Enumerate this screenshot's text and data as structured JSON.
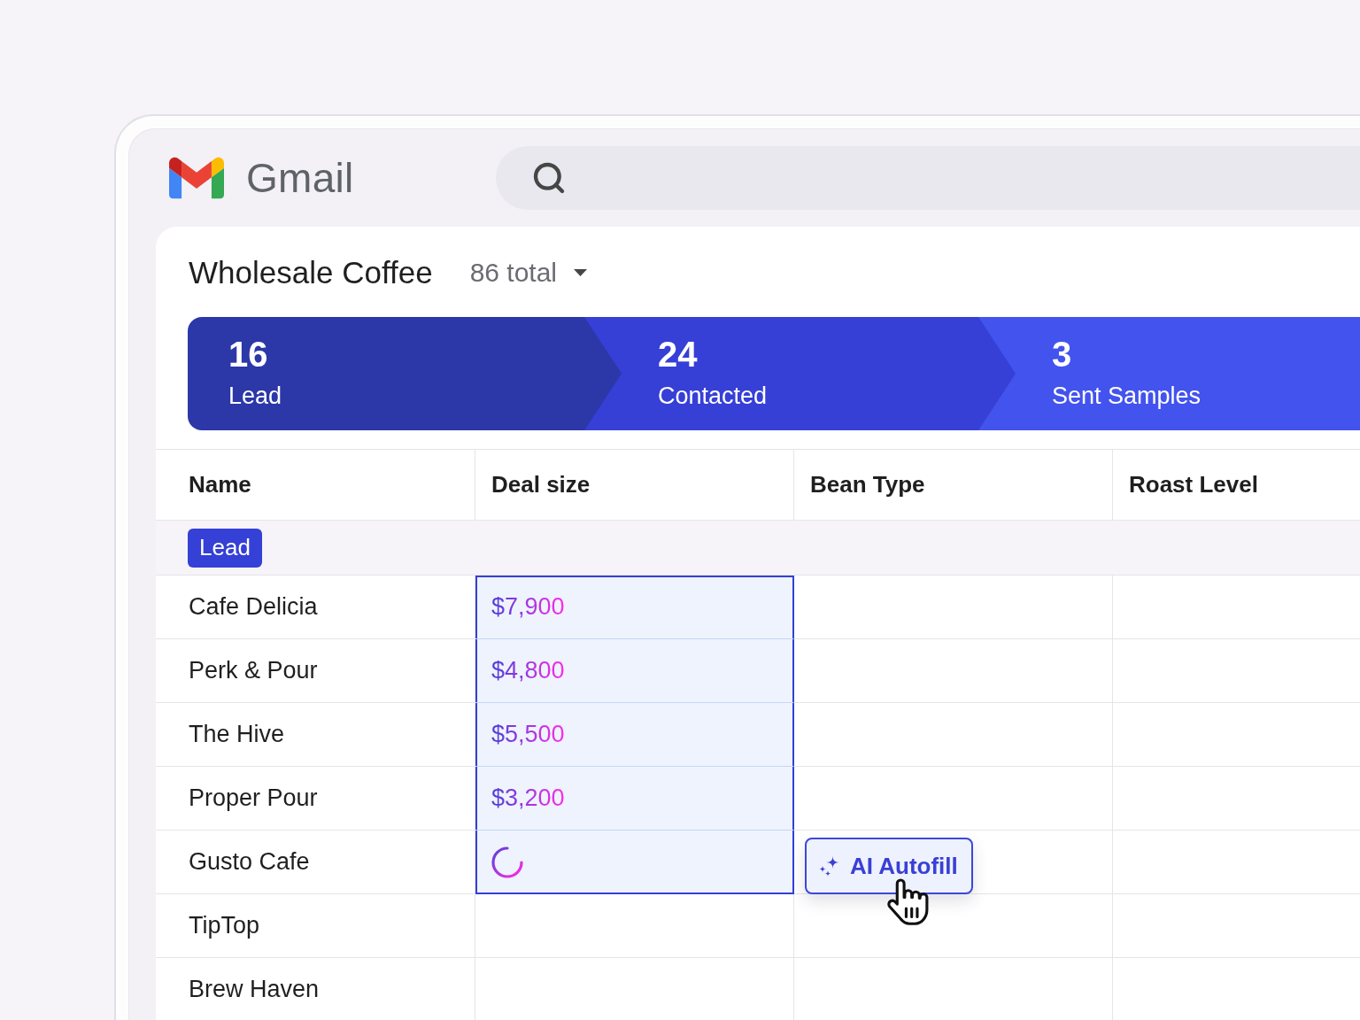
{
  "app": {
    "name": "Gmail"
  },
  "view": {
    "title": "Wholesale Coffee",
    "total": "86 total"
  },
  "pipeline": {
    "stages": [
      {
        "count": "16",
        "label": "Lead",
        "color": "#2c37a8"
      },
      {
        "count": "24",
        "label": "Contacted",
        "color": "#3640d6"
      },
      {
        "count": "3",
        "label": "Sent Samples",
        "color": "#4353ee"
      }
    ]
  },
  "table": {
    "columns": [
      "Name",
      "Deal size",
      "Bean Type",
      "Roast Level"
    ],
    "groups": [
      {
        "badge": "Lead",
        "rows": [
          {
            "name": "Cafe Delicia",
            "deal_size": "$7,900",
            "selected": true,
            "loading": false
          },
          {
            "name": "Perk & Pour",
            "deal_size": "$4,800",
            "selected": true,
            "loading": false
          },
          {
            "name": "The Hive",
            "deal_size": "$5,500",
            "selected": true,
            "loading": false
          },
          {
            "name": "Proper Pour",
            "deal_size": "$3,200",
            "selected": true,
            "loading": false
          },
          {
            "name": "Gusto Cafe",
            "selected": true,
            "loading": true
          },
          {
            "name": "TipTop",
            "selected": false,
            "loading": false
          },
          {
            "name": "Brew Haven",
            "selected": false,
            "loading": false
          }
        ]
      }
    ],
    "autofill_button": {
      "label": "AI Autofill"
    }
  }
}
